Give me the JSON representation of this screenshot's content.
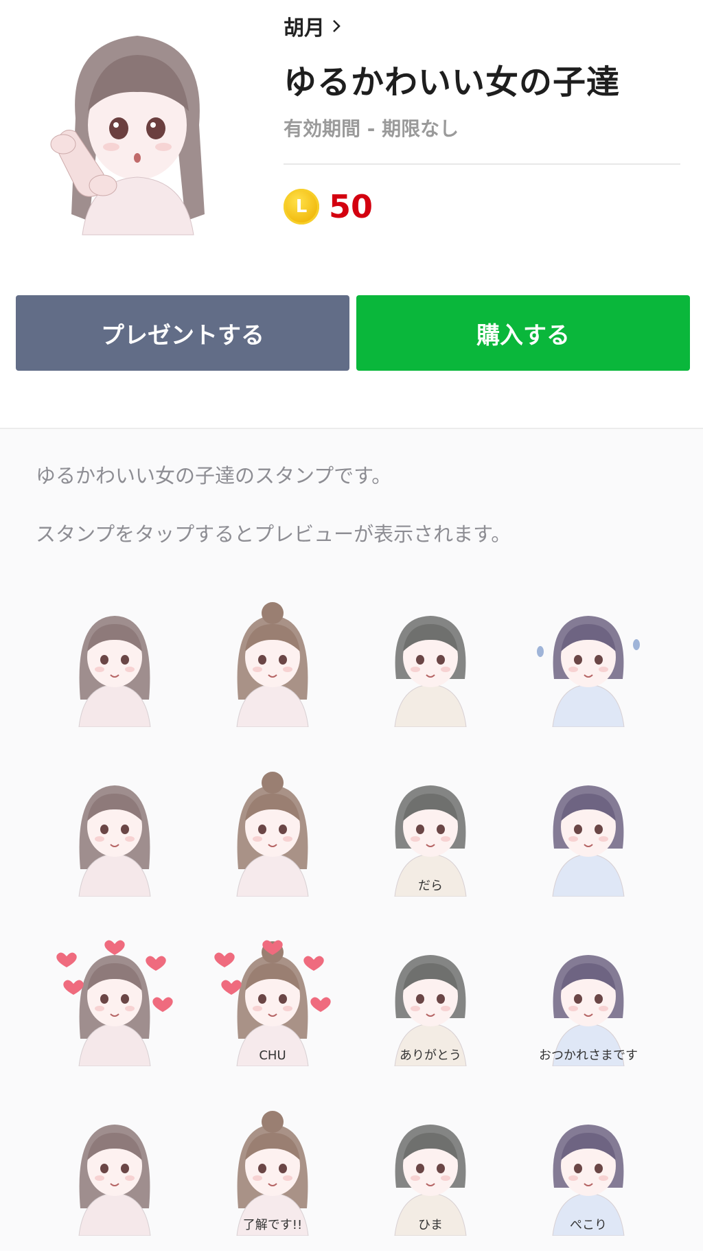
{
  "author": "胡月",
  "title": "ゆるかわいい女の子達",
  "validity": "有効期間 - 期限なし",
  "price": {
    "coin_letter": "L",
    "value": "50"
  },
  "buttons": {
    "present": "プレゼントする",
    "buy": "購入する"
  },
  "description": "ゆるかわいい女の子達のスタンプです。",
  "hint": "スタンプをタップするとプレビューが表示されます。",
  "colors": {
    "present_button": "#626d87",
    "buy_button": "#0ab73b",
    "price": "#d3000f",
    "coin": "#f1b90d"
  },
  "stickers": [
    {
      "name": "phone-long-hair",
      "hair": "#8e7a7a",
      "top": "#f5e8ea",
      "caption": ""
    },
    {
      "name": "bun-pray",
      "hair": "#9a7f72",
      "top": "#f6eaec",
      "caption": ""
    },
    {
      "name": "short-hair-sigh",
      "hair": "#6f706e",
      "top": "#f3ece4",
      "caption": ""
    },
    {
      "name": "bob-crying",
      "hair": "#6e6482",
      "top": "#dfe7f6",
      "caption": ""
    },
    {
      "name": "long-hair-annoyed",
      "hair": "#8e7a7a",
      "top": "#f5e8ea",
      "caption": ""
    },
    {
      "name": "bun-cheer",
      "hair": "#9a7f72",
      "top": "#f6eaec",
      "caption": ""
    },
    {
      "name": "short-hair-sweat",
      "hair": "#6f706e",
      "top": "#f3ece4",
      "caption": "だら"
    },
    {
      "name": "bob-surprised",
      "hair": "#6e6482",
      "top": "#dfe7f6",
      "caption": ""
    },
    {
      "name": "long-hair-hearts",
      "hair": "#8e7a7a",
      "top": "#f5e8ea",
      "caption": ""
    },
    {
      "name": "bun-chu",
      "hair": "#9a7f72",
      "top": "#f6eaec",
      "caption": "CHU"
    },
    {
      "name": "short-hair-thanks",
      "hair": "#6f706e",
      "top": "#f3ece4",
      "caption": "ありがとう"
    },
    {
      "name": "bob-otsukare",
      "hair": "#6e6482",
      "top": "#dfe7f6",
      "caption": "おつかれさまです"
    },
    {
      "name": "long-hair-yawn",
      "hair": "#8e7a7a",
      "top": "#f5e8ea",
      "caption": ""
    },
    {
      "name": "bun-ryokai",
      "hair": "#9a7f72",
      "top": "#f6eaec",
      "caption": "了解です!!"
    },
    {
      "name": "short-hair-bored",
      "hair": "#6f706e",
      "top": "#f3ece4",
      "caption": "ひま"
    },
    {
      "name": "bob-bow",
      "hair": "#6e6482",
      "top": "#dfe7f6",
      "caption": "ぺこり"
    }
  ]
}
